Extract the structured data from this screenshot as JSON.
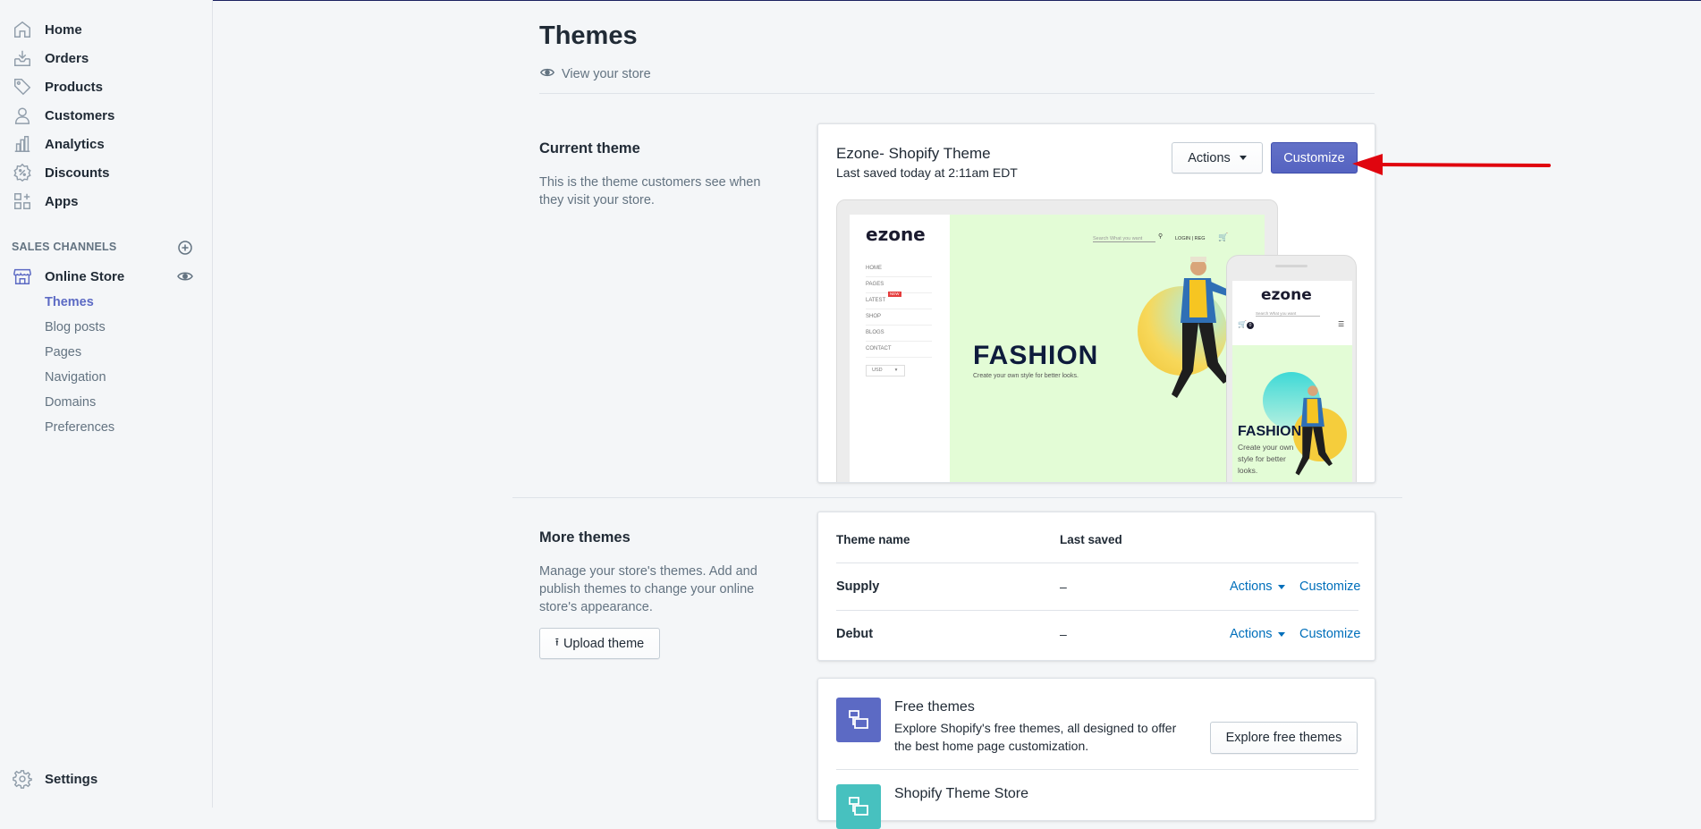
{
  "sidebar": {
    "items": [
      {
        "label": "Home",
        "icon": "home-icon"
      },
      {
        "label": "Orders",
        "icon": "orders-icon"
      },
      {
        "label": "Products",
        "icon": "tag-icon"
      },
      {
        "label": "Customers",
        "icon": "person-icon"
      },
      {
        "label": "Analytics",
        "icon": "bar-chart-icon"
      },
      {
        "label": "Discounts",
        "icon": "discount-icon"
      },
      {
        "label": "Apps",
        "icon": "apps-icon"
      }
    ],
    "sales_channels_heading": "SALES CHANNELS",
    "online_store": {
      "label": "Online Store",
      "icon": "store-icon"
    },
    "sub_items": [
      "Themes",
      "Blog posts",
      "Pages",
      "Navigation",
      "Domains",
      "Preferences"
    ],
    "settings": {
      "label": "Settings",
      "icon": "gear-icon"
    }
  },
  "header": {
    "title": "Themes",
    "view_store": "View your store"
  },
  "current_theme": {
    "section_title": "Current theme",
    "section_desc": "This is the theme customers see when they visit your store.",
    "name": "Ezone- Shopify Theme",
    "last_saved": "Last saved today at 2:11am EDT",
    "actions_label": "Actions",
    "customize_label": "Customize",
    "preview": {
      "logo": "ezone",
      "menu": [
        "HOME",
        "PAGES",
        "LATEST",
        "SHOP",
        "BLOGS",
        "CONTACT"
      ],
      "new_badge": "NEW",
      "currency": "USD",
      "search_placeholder": "Search What you want",
      "login": "LOGIN | REG",
      "hero_title": "FASHION",
      "hero_sub": "Create your own style for better looks.",
      "mobile_title": "FASHION",
      "mobile_sub": "Create your own style for better looks.",
      "cart_count": "0"
    }
  },
  "more_themes": {
    "section_title": "More themes",
    "section_desc": "Manage your store's themes. Add and publish themes to change your online store's appearance.",
    "upload_label": "Upload theme",
    "columns": [
      "Theme name",
      "Last saved"
    ],
    "rows": [
      {
        "name": "Supply",
        "saved": "–",
        "actions": "Actions",
        "customize": "Customize"
      },
      {
        "name": "Debut",
        "saved": "–",
        "actions": "Actions",
        "customize": "Customize"
      }
    ]
  },
  "free_themes": {
    "title": "Free themes",
    "desc": "Explore Shopify's free themes, all designed to offer the best home page customization.",
    "button": "Explore free themes",
    "icon_color": "#5c6ac4"
  },
  "theme_store": {
    "title": "Shopify Theme Store",
    "icon_color": "#47c1bf"
  },
  "colors": {
    "accent": "#5c6ac4",
    "link": "#006fbb",
    "arrow": "#e0050f"
  }
}
